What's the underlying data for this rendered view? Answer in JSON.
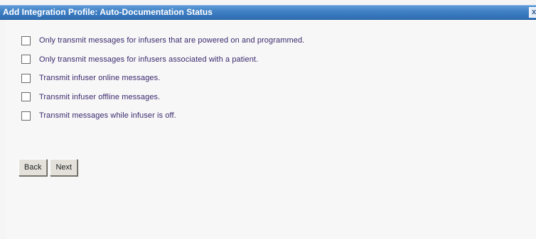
{
  "dialog": {
    "title": "Add Integration Profile: Auto-Documentation Status",
    "close_label": "x"
  },
  "options": [
    {
      "label": "Only transmit messages for infusers that are powered on and programmed.",
      "checked": false
    },
    {
      "label": "Only transmit messages for infusers associated with a patient.",
      "checked": false
    },
    {
      "label": "Transmit infuser online messages.",
      "checked": false
    },
    {
      "label": "Transmit infuser offline messages.",
      "checked": false
    },
    {
      "label": "Transmit messages while infuser is off.",
      "checked": false
    }
  ],
  "buttons": {
    "back_label": "Back",
    "next_label": "Next"
  },
  "colors": {
    "titlebar": "#3f7fc4",
    "label_text": "#3b2a6e",
    "background": "#f7f7f7"
  }
}
